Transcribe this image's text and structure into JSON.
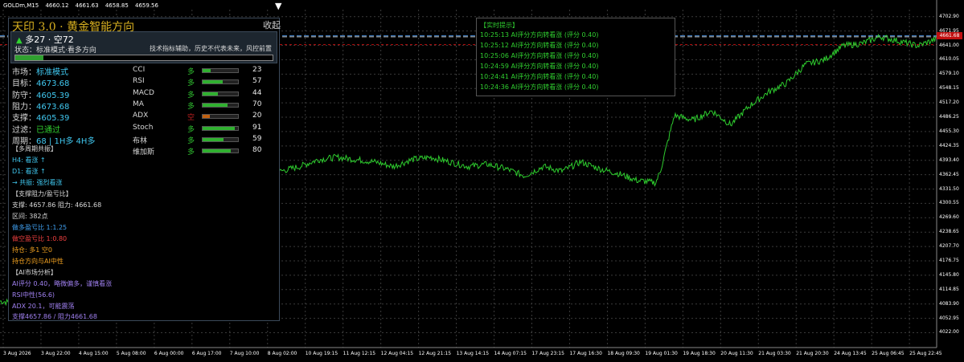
{
  "chart_header": {
    "symbol": "GOLDm,M15",
    "ohlc": [
      "4660.12",
      "4661.63",
      "4658.85",
      "4659.56"
    ]
  },
  "panel": {
    "title": "天印 3.0 · 黄金智能方向",
    "collapse_label": "收起",
    "collapse_arrow": "▼",
    "score_arrow": "▲",
    "score": "多27 · 空72",
    "status": "状态：标准模式·看多方向",
    "disclaimer": "技术指标辅助，历史不代表未来，风控前置",
    "main_progress": 0.11,
    "rows": [
      {
        "label": "市场：",
        "value": "标准模式",
        "color": "cyan"
      },
      {
        "label": "目标：",
        "value": "4673.68",
        "color": "cyan"
      },
      {
        "label": "防守：",
        "value": "4605.39",
        "color": "cyan"
      },
      {
        "label": "阻力：",
        "value": "4673.68",
        "color": "cyan"
      },
      {
        "label": "支撑：",
        "value": "4605.39",
        "color": "cyan"
      },
      {
        "label": "过滤：",
        "value": "已通过",
        "color": "green"
      },
      {
        "label": "周期：",
        "value": "68 | 1H多 4H多",
        "color": "cyan"
      }
    ],
    "indicators": [
      {
        "name": "CCI",
        "dir": "多",
        "value": "23",
        "level": 0.23,
        "color": "#30c030"
      },
      {
        "name": "RSI",
        "dir": "多",
        "value": "57",
        "level": 0.57,
        "color": "#30c030"
      },
      {
        "name": "MACD",
        "dir": "多",
        "value": "44",
        "level": 0.44,
        "color": "#30c030"
      },
      {
        "name": "MA",
        "dir": "多",
        "value": "70",
        "level": 0.7,
        "color": "#30c030"
      },
      {
        "name": "ADX",
        "dir": "空",
        "value": "20",
        "level": 0.2,
        "color": "#c02020"
      },
      {
        "name": "Stoch",
        "dir": "多",
        "value": "91",
        "level": 0.91,
        "color": "#30c030"
      },
      {
        "name": "布林",
        "dir": "多",
        "value": "59",
        "level": 0.59,
        "color": "#30c030"
      },
      {
        "name": "维加斯",
        "dir": "多",
        "value": "80",
        "level": 0.8,
        "color": "#30c030"
      }
    ],
    "multi_title": "【多周期共振】",
    "multi_lines": [
      "H4: 看涨 ↑",
      "D1: 看涨 ↑",
      "→ 共振: 强烈看涨"
    ],
    "sr_title": "【支撑阻力/盈亏比】",
    "sr_lines": [
      "支撑: 4657.86 阻力: 4661.68",
      "区间: 382点"
    ],
    "rr_long": "做多盈亏比 1:1.25",
    "rr_short": "做空盈亏比 1:0.80",
    "position": "持仓: 多1 空0",
    "position_note": "持仓方向与AI中性",
    "ai_title": "【AI市场分析】",
    "ai_lines": [
      "AI评分 0.40，略微偏多，谨慎看涨",
      "RSI中性(56.6)",
      "ADX 20.1，可能震荡",
      "支撑4657.86 / 阻力4661.68"
    ]
  },
  "realtime": {
    "title": "【实时提示】",
    "items": [
      "10:25:13 AI评分方向转看涨 (评分 0.40)",
      "10:25:12 AI评分方向转看涨 (评分 0.40)",
      "10:25:06 AI评分方向转看涨 (评分 0.40)",
      "10:24:59 AI评分方向转看涨 (评分 0.40)",
      "10:24:41 AI评分方向转看涨 (评分 0.40)",
      "10:24:36 AI评分方向转看涨 (评分 0.40)"
    ]
  },
  "chart_data": {
    "type": "line",
    "price_tag": "4661.68",
    "current_price": 4661.68,
    "dashed_levels": [
      4661.68,
      4659.5
    ],
    "red_level": 4642.5,
    "ylim": [
      3990,
      4718
    ],
    "y_ticks": [
      "4702.90",
      "4671.95",
      "4641.00",
      "4610.05",
      "4579.10",
      "4548.15",
      "4517.20",
      "4486.25",
      "4455.30",
      "4424.35",
      "4393.40",
      "4362.45",
      "4331.50",
      "4300.55",
      "4269.60",
      "4238.65",
      "4207.70",
      "4176.75",
      "4145.80",
      "4114.85",
      "4083.90",
      "4052.95",
      "4022.00"
    ],
    "y_values": [
      4702.9,
      4671.95,
      4641.0,
      4610.05,
      4579.1,
      4548.15,
      4517.2,
      4486.25,
      4455.3,
      4424.35,
      4393.4,
      4362.45,
      4331.5,
      4300.55,
      4269.6,
      4238.65,
      4207.7,
      4176.75,
      4145.8,
      4114.85,
      4083.9,
      4052.95,
      4022.0
    ],
    "x_ticks": [
      "3 Aug 2026",
      "3 Aug 22:00",
      "4 Aug 15:00",
      "5 Aug 08:00",
      "6 Aug 00:00",
      "6 Aug 17:00",
      "7 Aug 10:00",
      "8 Aug 02:00",
      "10 Aug 19:15",
      "11 Aug 12:15",
      "12 Aug 04:15",
      "12 Aug 21:15",
      "13 Aug 14:15",
      "14 Aug 07:15",
      "17 Aug 23:15",
      "17 Aug 16:30",
      "18 Aug 09:30",
      "19 Aug 01:30",
      "19 Aug 18:30",
      "20 Aug 11:30",
      "21 Aug 03:30",
      "21 Aug 20:30",
      "24 Aug 13:45",
      "25 Aug 06:45",
      "25 Aug 22:45"
    ],
    "series": [
      {
        "x": [
          0,
          0.02,
          0.04,
          0.06,
          0.08,
          0.1,
          0.12,
          0.14,
          0.16,
          0.18,
          0.2,
          0.22,
          0.24,
          0.26,
          0.28,
          0.3,
          0.32,
          0.34,
          0.36,
          0.38,
          0.4,
          0.42,
          0.44,
          0.46,
          0.48,
          0.5,
          0.52,
          0.54,
          0.56,
          0.58,
          0.6,
          0.62,
          0.64,
          0.66,
          0.68,
          0.7,
          0.705,
          0.72,
          0.74,
          0.76,
          0.78,
          0.8,
          0.82,
          0.84,
          0.86,
          0.88,
          0.9,
          0.92,
          0.94,
          0.96,
          0.98,
          1.0
        ],
        "values": [
          4090,
          4085,
          4078,
          4080,
          4070,
          4260,
          4280,
          4290,
          4300,
          4320,
          4330,
          4335,
          4345,
          4350,
          4355,
          4370,
          4380,
          4395,
          4400,
          4395,
          4390,
          4380,
          4395,
          4400,
          4390,
          4380,
          4385,
          4375,
          4360,
          4380,
          4370,
          4390,
          4375,
          4365,
          4350,
          4345,
          4370,
          4490,
          4480,
          4500,
          4470,
          4510,
          4540,
          4560,
          4600,
          4610,
          4640,
          4645,
          4660,
          4650,
          4640,
          4655
        ]
      }
    ]
  }
}
